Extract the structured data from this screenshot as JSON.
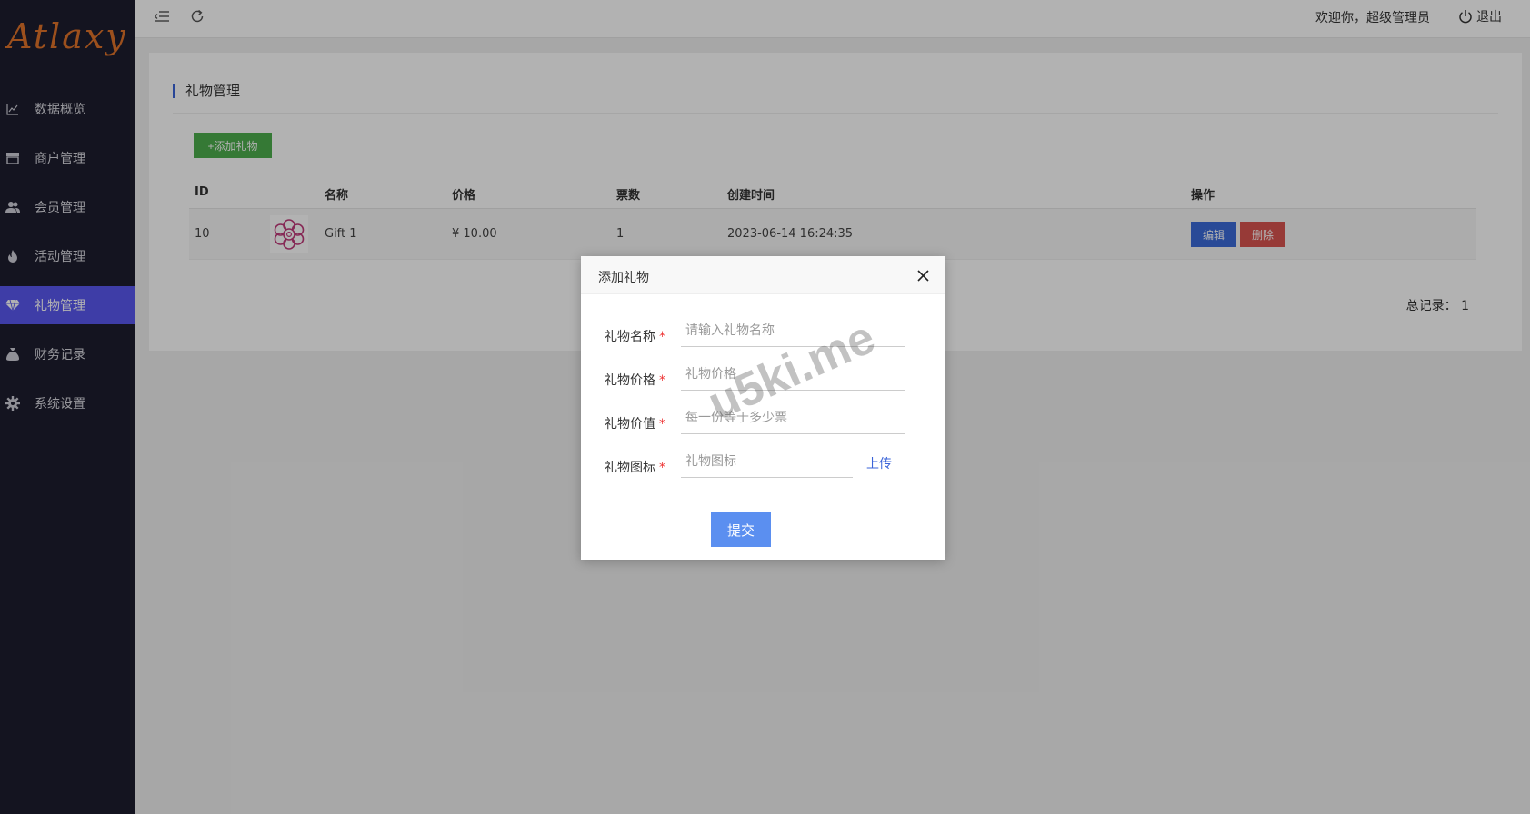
{
  "app": {
    "logo_text": "Atlaxy"
  },
  "sidebar": {
    "items": [
      {
        "label": "数据概览",
        "icon": "chart-line-icon"
      },
      {
        "label": "商户管理",
        "icon": "store-icon"
      },
      {
        "label": "会员管理",
        "icon": "users-icon"
      },
      {
        "label": "活动管理",
        "icon": "flame-icon"
      },
      {
        "label": "礼物管理",
        "icon": "diamond-icon",
        "active": true
      },
      {
        "label": "财务记录",
        "icon": "money-bag-icon"
      },
      {
        "label": "系统设置",
        "icon": "gear-icon"
      }
    ]
  },
  "topbar": {
    "welcome": "欢迎你，超级管理员",
    "logout_label": "退出"
  },
  "main": {
    "title": "礼物管理",
    "add_button": "+添加礼物",
    "table": {
      "headers": {
        "id": "ID",
        "name": "名称",
        "price": "价格",
        "votes": "票数",
        "created": "创建时间",
        "actions": "操作"
      },
      "rows": [
        {
          "id": "10",
          "name": "Gift 1",
          "price": "¥ 10.00",
          "votes": "1",
          "created": "2023-06-14 16:24:35",
          "edit_label": "编辑",
          "delete_label": "删除"
        }
      ]
    },
    "total": "总记录： 1"
  },
  "modal": {
    "title": "添加礼物",
    "fields": {
      "name": {
        "label": "礼物名称",
        "placeholder": "请输入礼物名称",
        "value": ""
      },
      "price": {
        "label": "礼物价格",
        "placeholder": "礼物价格",
        "value": ""
      },
      "worth": {
        "label": "礼物价值",
        "placeholder": "每一份等于多少票",
        "value": ""
      },
      "icon": {
        "label": "礼物图标",
        "placeholder": "礼物图标",
        "value": ""
      }
    },
    "upload_label": "上传",
    "submit_label": "提交"
  },
  "watermark": "u5ki.me",
  "colors": {
    "accent": "#5a58f0",
    "add_green": "#4cae4c",
    "edit_blue": "#3b6ad8",
    "delete_red": "#d9534f",
    "logo_orange": "#e0732a"
  }
}
